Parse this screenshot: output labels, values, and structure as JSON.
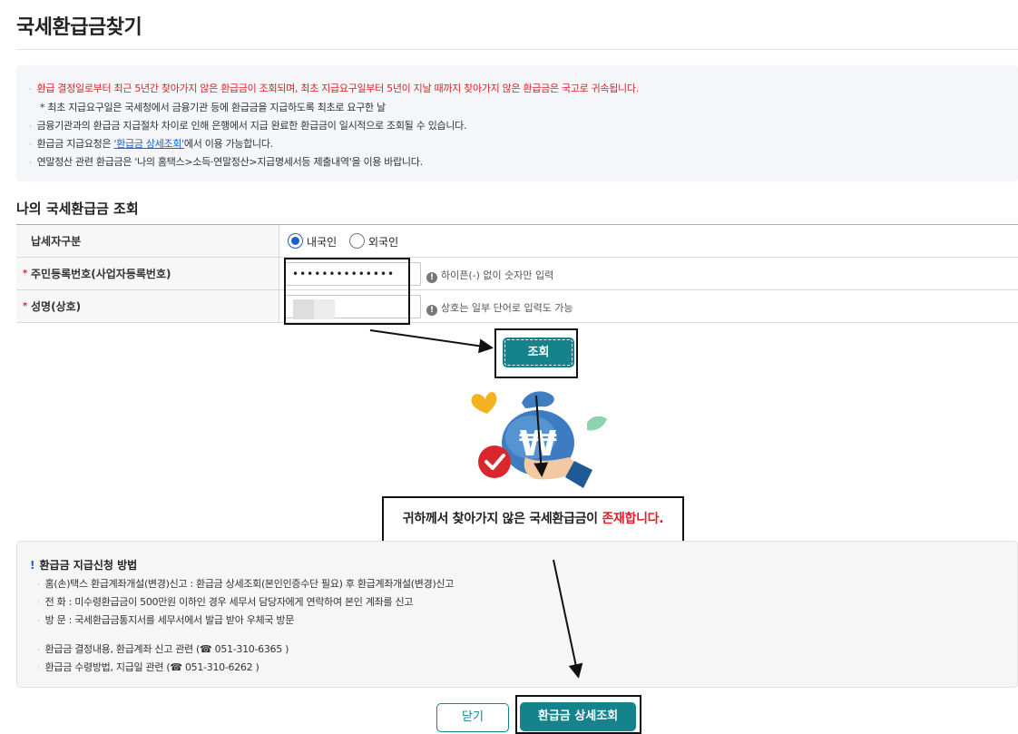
{
  "page": {
    "title": "국세환급금찾기"
  },
  "notice": {
    "lines": [
      "환급 결정일로부터 최근 5년간 찾아가지 않은 환급금이 조회되며, 최초 지급요구일부터 5년이 지날 때까지 찾아가지 않은 환급금은 국고로 귀속됩니다.",
      "* 최초 지급요구일은 국세청에서 금융기관 등에 환급금을 지급하도록 최초로 요구한 날",
      "금융기관과의 환급금 지급절차 차이로 인해 은행에서 지급 완료한 환급금이 일시적으로 조회될 수 있습니다.",
      "연말정산 관련 환급금은 '나의 홈택스>소득·연말정산>지급명세서등 제출내역'을 이용 바랍니다."
    ],
    "request_prefix": "환급금 지급요청은 ",
    "request_link": "'환급금 상세조회'",
    "request_suffix": "에서 이용 가능합니다."
  },
  "form": {
    "section_title": "나의 국세환급금 조회",
    "taxpayer_type_label": "납세자구분",
    "options": [
      "내국인",
      "외국인"
    ],
    "selected_option": "내국인",
    "required_mark": "*",
    "id_label": "주민등록번호(사업자등록번호)",
    "id_value": "••••••••••••••",
    "id_hint": "하이픈(-) 없이 숫자만 입력",
    "name_label": "성명(상호)",
    "name_hint": "상호는 일부 단어로 입력도 가능",
    "hint_icon": "!",
    "search_button": "조회"
  },
  "result": {
    "text_prefix": "귀하께서 찾아가지 않은 국세환급금이 ",
    "text_highlight": "존재합니다."
  },
  "info": {
    "icon": "!",
    "title": "환급금 지급신청 방법",
    "method_lines": [
      "홈(손)택스 환급계좌개설(변경)신고 : 환급금 상세조회(본인인증수단 필요) 후 환급계좌개설(변경)신고",
      "전 화 : 미수령환급금이 500만원 이하인 경우 세무서 담당자에게 연락하여 본인 계좌를 신고",
      "방 문 : 국세환급금통지서를 세무서에서 발급 받아 우체국 방문"
    ],
    "contact_lines": [
      "환급금 결정내용, 환급계좌 신고 관련 (☎ 051-310-6365 )",
      "환급금 수령방법, 지급일 관련 (☎ 051-310-6262 )"
    ]
  },
  "buttons": {
    "close": "닫기",
    "detail": "환급금 상세조회"
  },
  "colors": {
    "accent": "#14838c",
    "alert": "#e0202a",
    "link": "#1a5fd0"
  },
  "illustration": {
    "icon": "money-bag-icon",
    "currency_symbol": "₩"
  }
}
